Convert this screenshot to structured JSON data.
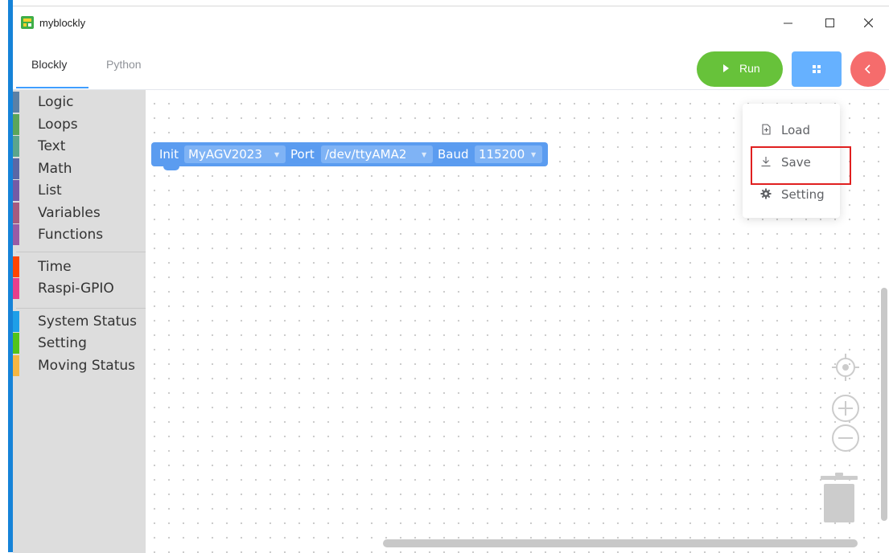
{
  "window": {
    "title": "myblockly",
    "controls": [
      "minimize-icon",
      "maximize-icon",
      "close-icon"
    ]
  },
  "tabs": [
    {
      "label": "Blockly",
      "active": true
    },
    {
      "label": "Python",
      "active": false
    }
  ],
  "toolbar": {
    "run_label": "Run",
    "run_color": "#67c23a",
    "menu_button_color": "#66b1ff",
    "back_button_color": "#f56c6c"
  },
  "toolbox": {
    "groups": [
      [
        {
          "label": "Logic",
          "color": "#5b80a5"
        },
        {
          "label": "Loops",
          "color": "#5ba55b"
        },
        {
          "label": "Text",
          "color": "#5ba58c"
        },
        {
          "label": "Math",
          "color": "#5b67a5"
        },
        {
          "label": "List",
          "color": "#745ba5"
        },
        {
          "label": "Variables",
          "color": "#a55b80"
        },
        {
          "label": "Functions",
          "color": "#995ba5"
        }
      ],
      [
        {
          "label": "Time",
          "color": "#ff4500"
        },
        {
          "label": "Raspi-GPIO",
          "color": "#e83e8c"
        }
      ],
      [
        {
          "label": "System Status",
          "color": "#1e9fe8"
        },
        {
          "label": "Setting",
          "color": "#52c41a"
        },
        {
          "label": "Moving Status",
          "color": "#f5b642"
        }
      ]
    ]
  },
  "block": {
    "init_label": "Init",
    "name_value": "MyAGV2023",
    "port_label": "Port",
    "port_value": "/dev/ttyAMA2",
    "baud_label": "Baud",
    "baud_value": "115200",
    "color": "#5b9cf0"
  },
  "menu": {
    "items": [
      {
        "label": "Load",
        "icon": "file-import-icon"
      },
      {
        "label": "Save",
        "icon": "download-icon"
      },
      {
        "label": "Setting",
        "icon": "gear-icon"
      }
    ],
    "highlighted": "Save",
    "highlight_color": "#e02020"
  },
  "workspace_controls": [
    "recenter-icon",
    "zoom-in-icon",
    "zoom-out-icon",
    "trash-icon"
  ]
}
